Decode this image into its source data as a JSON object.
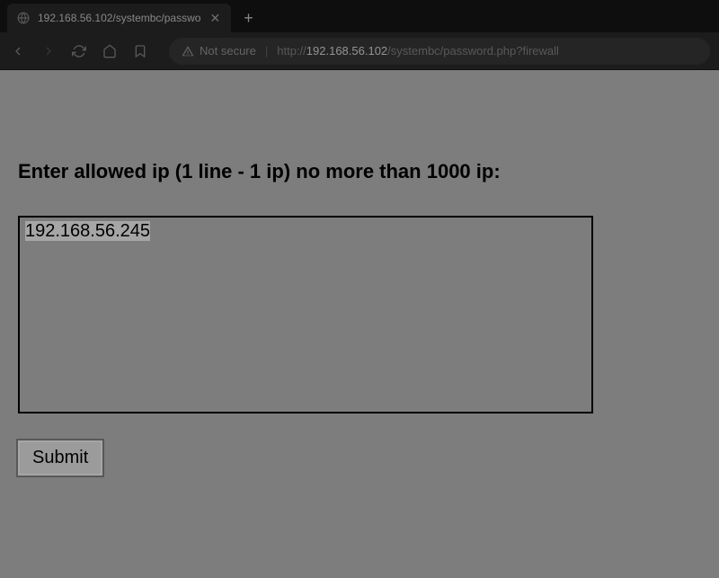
{
  "browser": {
    "tab": {
      "title": "192.168.56.102/systembc/passwo"
    },
    "address": {
      "not_secure_label": "Not secure",
      "url_scheme": "http://",
      "url_host": "192.168.56.102",
      "url_path": "/systembc/password.php?firewall"
    }
  },
  "page": {
    "heading": "Enter allowed ip (1 line - 1 ip) no more than 1000 ip:",
    "textarea_value": "192.168.56.245",
    "submit_label": "Submit"
  }
}
